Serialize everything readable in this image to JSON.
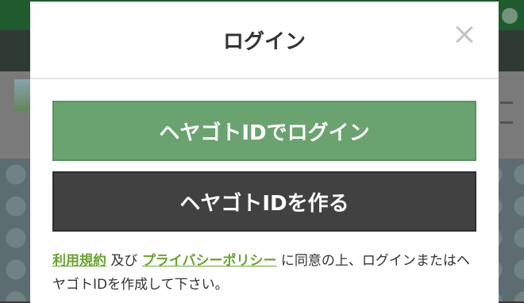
{
  "modal": {
    "title": "ログイン",
    "close_label": "✕"
  },
  "buttons": {
    "login": "ヘヤゴトIDでログイン",
    "create": "ヘヤゴトIDを作る"
  },
  "terms": {
    "terms_link": "利用規約",
    "connector": "及び",
    "privacy_link": "プライバシーポリシー",
    "text_after": "に同意の上、ログインまたはヘヤゴトIDを作成して下さい。"
  },
  "colors": {
    "login_button": "#6aa36f",
    "create_button": "#404140",
    "link": "#6aa331"
  }
}
